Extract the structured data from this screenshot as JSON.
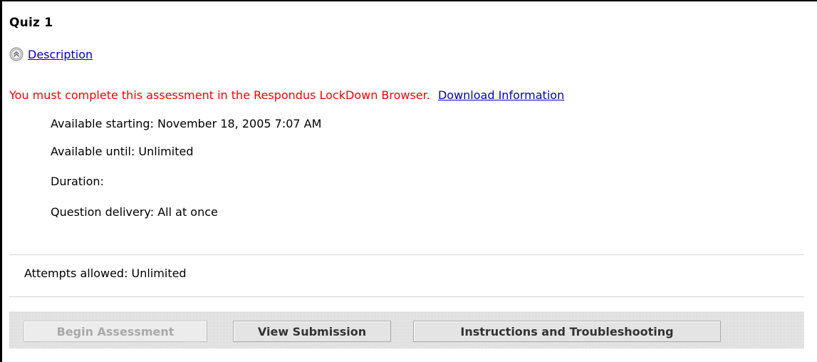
{
  "quiz": {
    "title": "Quiz 1",
    "description_link": " Description",
    "collapse_icon": "collapse-up-icon"
  },
  "lockdown": {
    "warning": "You must complete this assessment in the Respondus LockDown Browser.",
    "download_link": "Download Information"
  },
  "details": {
    "available_starting": "Available starting: November 18, 2005 7:07 AM",
    "available_until": "Available until: Unlimited",
    "duration": "Duration:",
    "question_delivery": "Question delivery: All at once"
  },
  "attempts": "Attempts allowed: Unlimited",
  "buttons": {
    "begin": "Begin Assessment",
    "view_submission": "View Submission",
    "instructions": "Instructions and Troubleshooting"
  },
  "colors": {
    "warning": "#ff0000",
    "link": "#0000cc",
    "disabled_text": "#a9a9a9"
  }
}
